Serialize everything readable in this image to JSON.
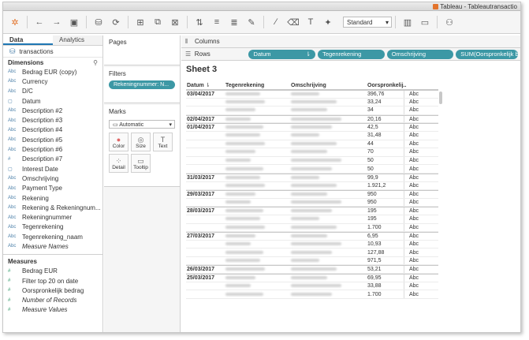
{
  "window": {
    "title": "Tableau - Tableautransactio"
  },
  "toolbar": {
    "view_select": "Standard"
  },
  "left": {
    "tabs": [
      "Data",
      "Analytics"
    ],
    "datasource": "transactions",
    "dimensions_header": "Dimensions",
    "dimensions": [
      {
        "icon": "Abc",
        "label": "Bedrag EUR (copy)"
      },
      {
        "icon": "Abc",
        "label": "Currency"
      },
      {
        "icon": "Abc",
        "label": "D/C"
      },
      {
        "icon": "▢",
        "label": "Datum"
      },
      {
        "icon": "Abc",
        "label": "Description #2"
      },
      {
        "icon": "Abc",
        "label": "Description #3"
      },
      {
        "icon": "Abc",
        "label": "Description #4"
      },
      {
        "icon": "Abc",
        "label": "Description #5"
      },
      {
        "icon": "Abc",
        "label": "Description #6"
      },
      {
        "icon": "#",
        "label": "Description #7"
      },
      {
        "icon": "▢",
        "label": "Interest Date"
      },
      {
        "icon": "Abc",
        "label": "Omschrijving"
      },
      {
        "icon": "Abc",
        "label": "Payment Type"
      },
      {
        "icon": "Abc",
        "label": "Rekening"
      },
      {
        "icon": "Abc",
        "label": "Rekening & Rekeningnum..."
      },
      {
        "icon": "Abc",
        "label": "Rekeningnummer"
      },
      {
        "icon": "Abc",
        "label": "Tegenrekening"
      },
      {
        "icon": "Abc",
        "label": "Tegenrekening_naam"
      },
      {
        "icon": "Abc",
        "label": "Measure Names",
        "italic": true
      }
    ],
    "measures_header": "Measures",
    "measures": [
      {
        "icon": "#",
        "label": "Bedrag EUR"
      },
      {
        "icon": "#",
        "label": "Filter top 20 on date"
      },
      {
        "icon": "#",
        "label": "Oorspronkelijk bedrag"
      },
      {
        "icon": "#",
        "label": "Number of Records",
        "italic": true
      },
      {
        "icon": "#",
        "label": "Measure Values",
        "italic": true
      }
    ]
  },
  "shelves": {
    "pages": "Pages",
    "filters": "Filters",
    "filter_pill": "Rekeningnummer: N...",
    "marks": "Marks",
    "marks_type": "Automatic",
    "mark_buttons": [
      "Color",
      "Size",
      "Text",
      "Detail",
      "Tooltip"
    ]
  },
  "main": {
    "columns_label": "Columns",
    "rows_label": "Rows",
    "row_pills": [
      "Datum",
      "Tegenrekening",
      "Omschrijving",
      "SUM(Oorspronkelijk b..."
    ],
    "sheet_title": "Sheet 3",
    "headers": [
      "Datum",
      "Tegenrekening",
      "Omschrijving",
      "Oorspronkelij.."
    ],
    "rows": [
      {
        "date": "03/04/2017",
        "val": "396,76",
        "abc": "Abc"
      },
      {
        "date": "",
        "val": "33,24",
        "abc": "Abc"
      },
      {
        "date": "",
        "val": "34",
        "abc": "Abc"
      },
      {
        "date": "02/04/2017",
        "val": "20,16",
        "abc": "Abc"
      },
      {
        "date": "01/04/2017",
        "val": "42,5",
        "abc": "Abc"
      },
      {
        "date": "",
        "val": "31,48",
        "abc": "Abc"
      },
      {
        "date": "",
        "val": "44",
        "abc": "Abc"
      },
      {
        "date": "",
        "val": "70",
        "abc": "Abc"
      },
      {
        "date": "",
        "val": "50",
        "abc": "Abc"
      },
      {
        "date": "",
        "val": "50",
        "abc": "Abc"
      },
      {
        "date": "31/03/2017",
        "val": "99,9",
        "abc": "Abc"
      },
      {
        "date": "",
        "val": "1.921,2",
        "abc": "Abc"
      },
      {
        "date": "29/03/2017",
        "val": "950",
        "abc": "Abc"
      },
      {
        "date": "",
        "val": "950",
        "abc": "Abc"
      },
      {
        "date": "28/03/2017",
        "val": "195",
        "abc": "Abc"
      },
      {
        "date": "",
        "val": "195",
        "abc": "Abc"
      },
      {
        "date": "",
        "val": "1.700",
        "abc": "Abc"
      },
      {
        "date": "27/03/2017",
        "val": "6,95",
        "abc": "Abc"
      },
      {
        "date": "",
        "val": "10,93",
        "abc": "Abc"
      },
      {
        "date": "",
        "val": "127,88",
        "abc": "Abc"
      },
      {
        "date": "",
        "val": "971,5",
        "abc": "Abc"
      },
      {
        "date": "26/03/2017",
        "val": "53,21",
        "abc": "Abc"
      },
      {
        "date": "25/03/2017",
        "val": "69,95",
        "abc": "Abc"
      },
      {
        "date": "",
        "val": "33,88",
        "abc": "Abc"
      },
      {
        "date": "",
        "val": "1.700",
        "abc": "Abc"
      }
    ]
  }
}
